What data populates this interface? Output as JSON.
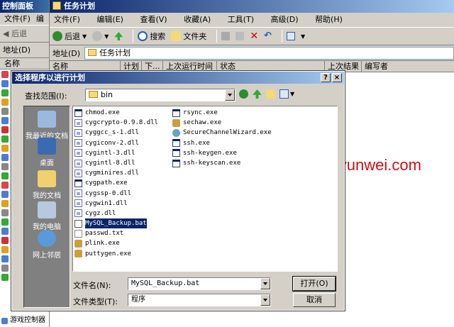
{
  "control_panel": {
    "title": "控制面板",
    "menu": [
      "文件(F)",
      "编"
    ],
    "back_label": "后退",
    "address_label": "地址(D)",
    "column_header": "名称",
    "last_item": "游戏控制器"
  },
  "task_scheduler": {
    "title": "任务计划",
    "menu": [
      "文件(F)",
      "编辑(E)",
      "查看(V)",
      "收藏(A)",
      "工具(T)",
      "高级(D)",
      "帮助(H)"
    ],
    "toolbar": {
      "back": "后退",
      "search": "搜索",
      "folders": "文件夹"
    },
    "address_label": "地址(D)",
    "address_value": "任务计划",
    "columns": [
      "名称",
      "计划",
      "下...",
      "上次运行时间",
      "状态",
      "上次结果",
      "编写者"
    ]
  },
  "dialog": {
    "title": "选择程序以进行计划",
    "help_button": "?",
    "close_button": "×",
    "look_in_label": "查找范围(I):",
    "look_in_value": "bin",
    "places": [
      "我最近的文档",
      "桌面",
      "我的文档",
      "我的电脑",
      "网上邻居"
    ],
    "files_col1": [
      {
        "name": "chmod.exe",
        "icon": "exe-icon"
      },
      {
        "name": "cygcrypto-0.9.8.dll",
        "icon": "dll-icon"
      },
      {
        "name": "cyggcc_s-1.dll",
        "icon": "dll-icon"
      },
      {
        "name": "cygiconv-2.dll",
        "icon": "dll-icon"
      },
      {
        "name": "cygintl-3.dll",
        "icon": "dll-icon"
      },
      {
        "name": "cygintl-8.dll",
        "icon": "dll-icon"
      },
      {
        "name": "cygminires.dll",
        "icon": "dll-icon"
      },
      {
        "name": "cygpath.exe",
        "icon": "exe-icon"
      },
      {
        "name": "cygssp-0.dll",
        "icon": "dll-icon"
      },
      {
        "name": "cygwin1.dll",
        "icon": "dll-icon"
      },
      {
        "name": "cygz.dll",
        "icon": "dll-icon"
      },
      {
        "name": "MySQL_Backup.bat",
        "icon": "bat-icon",
        "selected": true
      },
      {
        "name": "passwd.txt",
        "icon": "txt-icon"
      },
      {
        "name": "plink.exe",
        "icon": "app-icon"
      },
      {
        "name": "puttygen.exe",
        "icon": "app-icon"
      }
    ],
    "files_col2": [
      {
        "name": "rsync.exe",
        "icon": "exe-icon"
      },
      {
        "name": "sechaw.exe",
        "icon": "app-icon"
      },
      {
        "name": "SecureChannelWizard.exe",
        "icon": "globe-icon"
      },
      {
        "name": "ssh.exe",
        "icon": "exe-icon"
      },
      {
        "name": "ssh-keygen.exe",
        "icon": "exe-icon"
      },
      {
        "name": "ssh-keyscan.exe",
        "icon": "exe-icon"
      }
    ],
    "filename_label": "文件名(N):",
    "filename_value": "MySQL_Backup.bat",
    "filetype_label": "文件类型(T):",
    "filetype_value": "程序",
    "open_button": "打开(O)",
    "cancel_button": "取消"
  },
  "watermark": "www.osyunwei.com"
}
